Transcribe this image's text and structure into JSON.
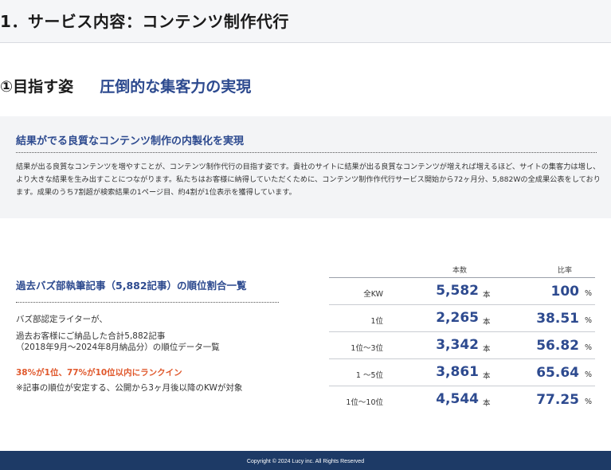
{
  "header": {
    "title": "1．サービス内容：コンテンツ制作代行"
  },
  "goal": {
    "label": "①目指す姿",
    "text": "圧倒的な集客力の実現"
  },
  "summary": {
    "heading": "結果がでる良質なコンテンツ制作の内製化を実現",
    "body": "結果が出る良質なコンテンツを増やすことが、コンテンツ制作代行の目指す姿です。貴社のサイトに結果が出る良質なコンテンツが増えれば増えるほど、サイトの集客力は増し、より大きな結果を生み出すことにつながります。私たちはお客様に納得していただくために、コンテンツ制作作代行サービス開始から72ヶ月分、5,882Wの全成果公表をしております。成果のうち7割超が検索結果の1ページ目、約4割が1位表示を獲得しています。"
  },
  "left": {
    "heading": "過去バズ部執筆記事（5,882記事）の順位割合一覧",
    "line1": "バズ部認定ライターが、",
    "line2": "過去お客様にご納品した合計5,882記事",
    "line3": "（2018年9月〜2024年8月納品分）の順位データ一覧",
    "accent": "38%が1位、77%が10位以内にランクイン",
    "note": "※記事の順位が安定する、公開から3ヶ月後以降のKWが対象"
  },
  "stats": {
    "col_count": "本数",
    "col_ratio": "比率",
    "count_unit": "本",
    "ratio_unit": "%",
    "rows": [
      {
        "rank": "全KW",
        "count": "5,582",
        "ratio": "100"
      },
      {
        "rank": "1位",
        "count": "2,265",
        "ratio": "38.51"
      },
      {
        "rank": "1位〜3位",
        "count": "3,342",
        "ratio": "56.82"
      },
      {
        "rank": "1 〜5位",
        "count": "3,861",
        "ratio": "65.64"
      },
      {
        "rank": "1位〜10位",
        "count": "4,544",
        "ratio": "77.25"
      }
    ]
  },
  "footer": {
    "copyright": "Copyright © 2024 Lucy inc. All Rights Reserved"
  }
}
